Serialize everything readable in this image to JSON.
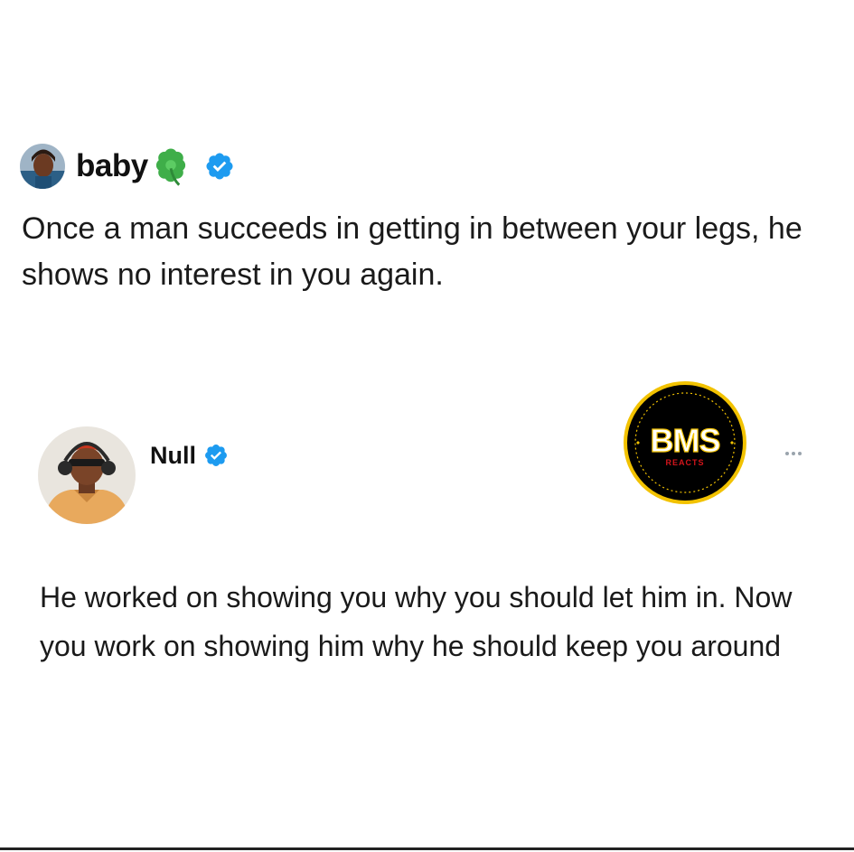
{
  "tweet1": {
    "display_name": "baby",
    "name_emoji": "four-leaf-clover-icon",
    "verified": true,
    "text": "Once a man succeeds in getting in between your legs, he shows no interest in you again."
  },
  "tweet2": {
    "display_name": "Null",
    "verified": true,
    "text": "He worked on showing you why you should let him in. Now you work on showing him why he should keep you around"
  },
  "watermark": {
    "title": "BMS",
    "subtitle": "REACTS"
  },
  "colors": {
    "verified_blue": "#1d9bf0",
    "clover_green": "#3fae49",
    "watermark_bg": "#000000",
    "watermark_ring": "#f2c200",
    "watermark_subtitle": "#d3151b",
    "more_dots": "#9aa4ad"
  },
  "icons": {
    "verified": "verified-badge-icon",
    "more": "more-options-icon"
  }
}
